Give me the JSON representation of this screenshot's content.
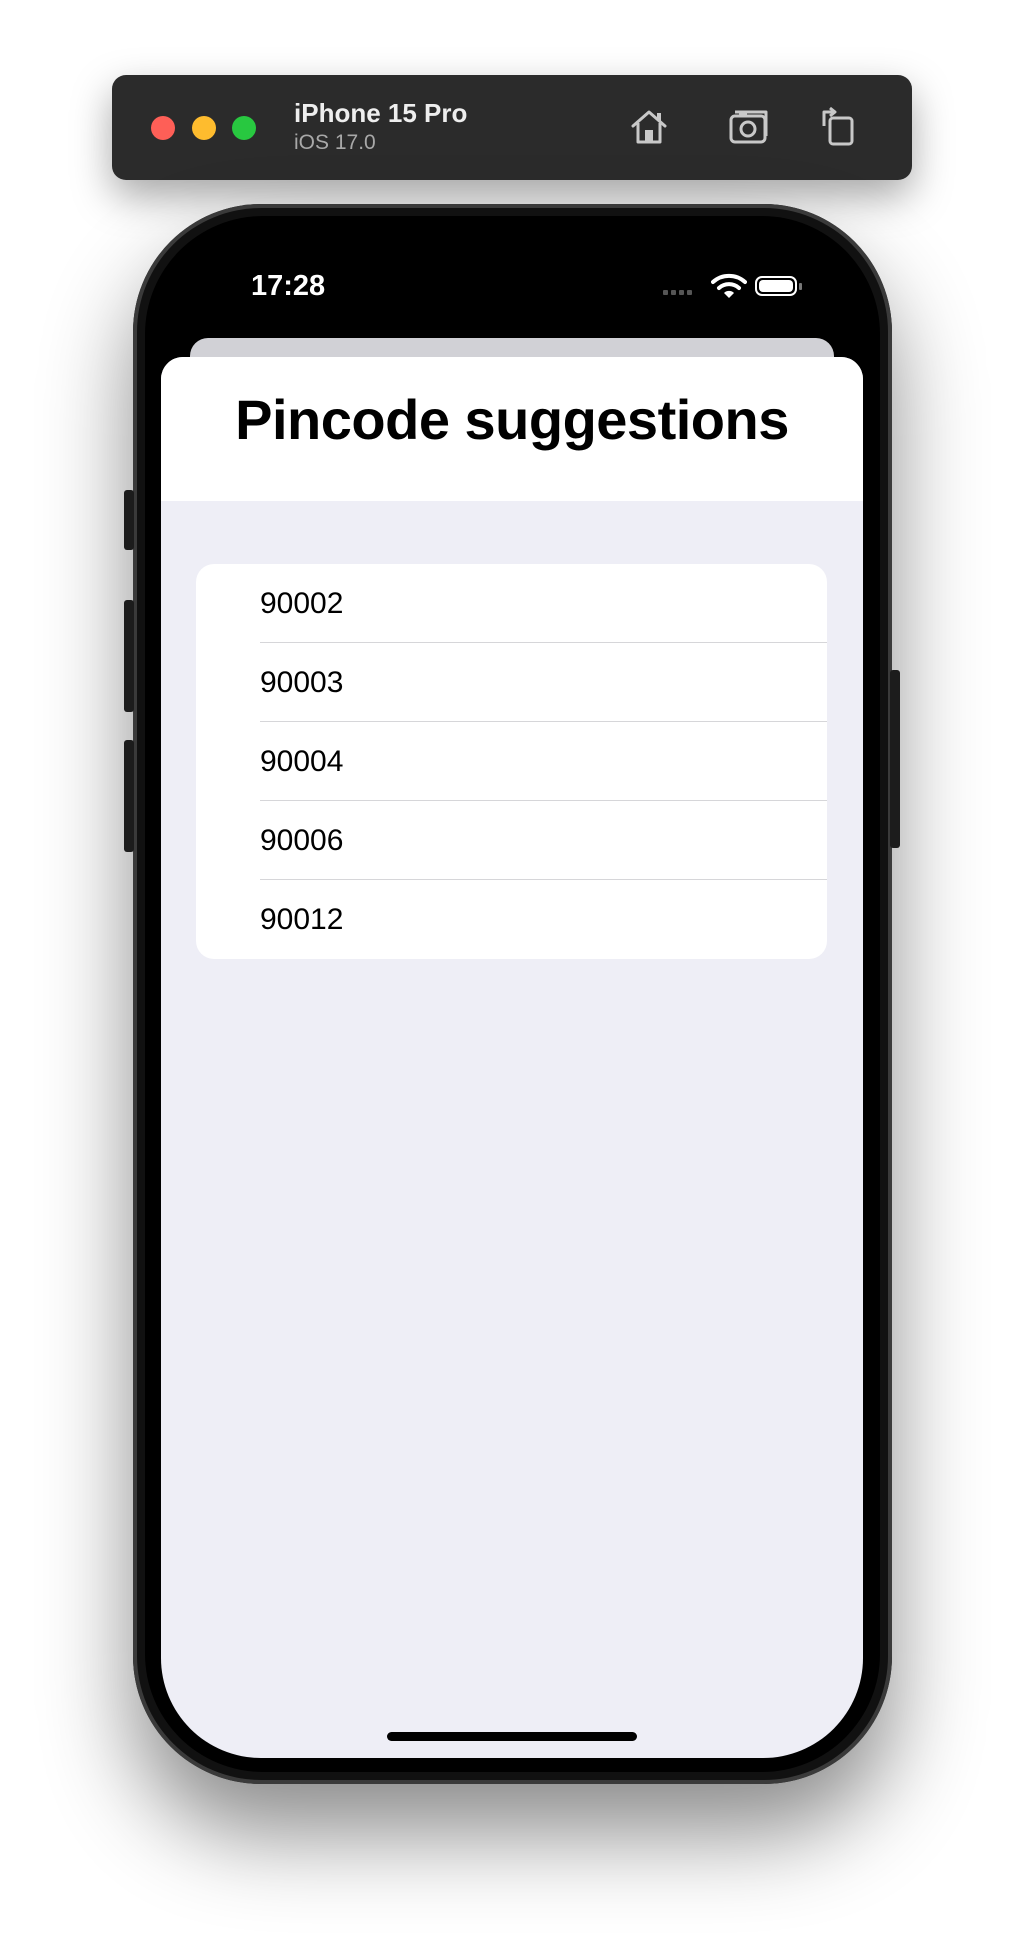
{
  "simulator": {
    "device_name": "iPhone 15 Pro",
    "os_version": "iOS 17.0",
    "buttons": [
      "home-icon",
      "screenshot-icon",
      "rotate-icon"
    ]
  },
  "status_bar": {
    "time": "17:28",
    "icons": [
      "cellular-signal-icon",
      "wifi-icon",
      "battery-icon"
    ]
  },
  "sheet": {
    "title": "Pincode suggestions",
    "items": [
      {
        "label": "90002"
      },
      {
        "label": "90003"
      },
      {
        "label": "90004"
      },
      {
        "label": "90006"
      },
      {
        "label": "90012"
      }
    ]
  },
  "colors": {
    "window_chrome": "#2b2b2b",
    "close": "#fe5f57",
    "minimize": "#febc2e",
    "zoom": "#28c840",
    "sheet_background": "#eeeef6",
    "list_background": "#ffffff"
  }
}
